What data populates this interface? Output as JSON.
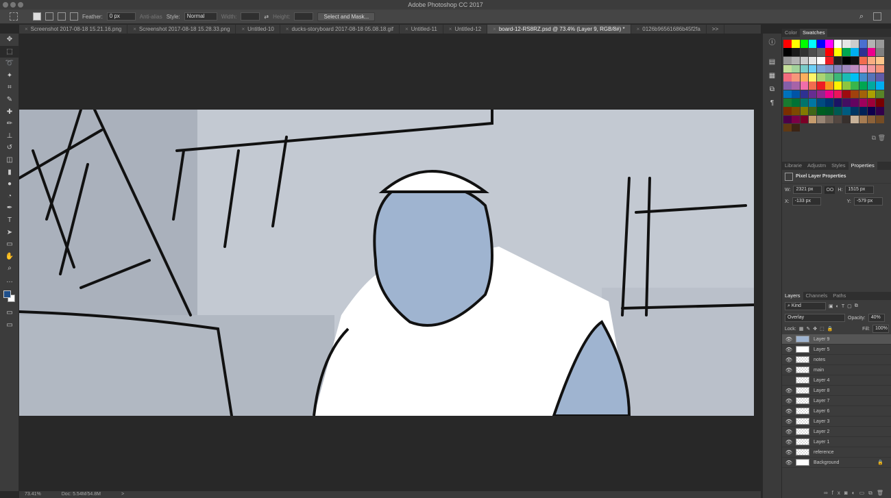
{
  "app": {
    "title": "Adobe Photoshop CC 2017"
  },
  "options": {
    "feather_label": "Feather:",
    "feather_value": "0 px",
    "antialias": "Anti-alias",
    "style_label": "Style:",
    "style_value": "Normal",
    "width_label": "Width:",
    "height_label": "Height:",
    "select_mask": "Select and Mask..."
  },
  "tabs": [
    "Screenshot 2017-08-18 15.21.16.png",
    "Screenshot 2017-08-18 15.28.33.png",
    "Untitled-10",
    "ducks-storyboard 2017-08-18 05.08.18.gif",
    "Untitled-11",
    "Untitled-12",
    "board-12-RS8RZ.psd @ 73.4% (Layer 9, RGB/8#) *",
    "0126b96561686b45f2fa"
  ],
  "tabs_overflow": ">>",
  "status": {
    "zoom": "73.41%",
    "doc": "Doc: 5.54M/54.8M",
    "arrow": ">"
  },
  "color_panel": {
    "tabs": [
      "Color",
      "Swatches"
    ]
  },
  "swatch_colors": [
    "#ff0000",
    "#ffff00",
    "#00ff00",
    "#00ffff",
    "#0000ff",
    "#ff00ff",
    "#ffffff",
    "#e6e6e6",
    "#cccccc",
    "#4a6fd0",
    "#b3b3b3",
    "#999999",
    "#000000",
    "#1a1a1a",
    "#333333",
    "#4d4d4d",
    "#666666",
    "#ff0000",
    "#ffff00",
    "#00a650",
    "#00aeef",
    "#2e3192",
    "#ec008c",
    "#808080",
    "#999999",
    "#b3b3b3",
    "#cccccc",
    "#e6e6e6",
    "#ffffff",
    "#ed1c24",
    "#231f20",
    "#000000",
    "#111111",
    "#f26c4f",
    "#f9ad81",
    "#fdc68a",
    "#c4df9b",
    "#a3d39c",
    "#7accc8",
    "#6dcff6",
    "#7da7d9",
    "#8393ca",
    "#8781bd",
    "#a187be",
    "#bd8cbf",
    "#f49ac1",
    "#f5989d",
    "#f69679",
    "#f26d7d",
    "#f7977a",
    "#fbaf5d",
    "#fff568",
    "#acd373",
    "#7cc576",
    "#3bb878",
    "#1abbb4",
    "#00bff3",
    "#438ccb",
    "#5574b9",
    "#605ca8",
    "#855fa8",
    "#a763a8",
    "#f06eaa",
    "#f26c4f",
    "#ed1c24",
    "#f7941d",
    "#fff200",
    "#8dc63f",
    "#39b54a",
    "#00a651",
    "#00a99d",
    "#00aeef",
    "#0072bc",
    "#0054a6",
    "#2e3192",
    "#662d91",
    "#92278f",
    "#ec008c",
    "#ed145b",
    "#9e0b0f",
    "#a0410d",
    "#a36209",
    "#aba000",
    "#598527",
    "#197b30",
    "#007236",
    "#00746b",
    "#0076a3",
    "#004a80",
    "#003471",
    "#1b1464",
    "#440e62",
    "#630460",
    "#9e005d",
    "#9e0039",
    "#790000",
    "#7b2e00",
    "#7d4900",
    "#827b00",
    "#406618",
    "#005e20",
    "#005826",
    "#005952",
    "#005b7f",
    "#003663",
    "#002157",
    "#0d004c",
    "#32004b",
    "#4b0049",
    "#7b0046",
    "#7a0026",
    "#c69c6d",
    "#998675",
    "#736357",
    "#534741",
    "#37302d",
    "#c7b299",
    "#a67c52",
    "#8c6239",
    "#754c24",
    "#603913",
    "#3c2415"
  ],
  "properties": {
    "tabs": [
      "Librarie",
      "Adjustm",
      "Styles",
      "Properties"
    ],
    "title": "Pixel Layer Properties",
    "w_label": "W:",
    "w": "2321 px",
    "h_label": "H:",
    "h": "1515 px",
    "x_label": "X:",
    "x": "-133 px",
    "y_label": "Y:",
    "y": "-579 px",
    "link": "OO"
  },
  "layers_panel": {
    "tabs": [
      "Layers",
      "Channels",
      "Paths"
    ],
    "filter": "Kind",
    "blend": "Overlay",
    "opacity_label": "Opacity:",
    "opacity": "40%",
    "lock_label": "Lock:",
    "fill_label": "Fill:",
    "fill": "100%",
    "layers": [
      {
        "name": "Layer 9",
        "visible": true,
        "selected": true
      },
      {
        "name": "Layer 5",
        "visible": true
      },
      {
        "name": "notes",
        "visible": true
      },
      {
        "name": "main",
        "visible": true
      },
      {
        "name": "Layer 4",
        "visible": false
      },
      {
        "name": "Layer 8",
        "visible": true
      },
      {
        "name": "Layer 7",
        "visible": true
      },
      {
        "name": "Layer 6",
        "visible": true
      },
      {
        "name": "Layer 3",
        "visible": true
      },
      {
        "name": "Layer 2",
        "visible": true
      },
      {
        "name": "Layer 1",
        "visible": true
      },
      {
        "name": "reference",
        "visible": true
      },
      {
        "name": "Background",
        "visible": true,
        "locked": true
      }
    ]
  }
}
